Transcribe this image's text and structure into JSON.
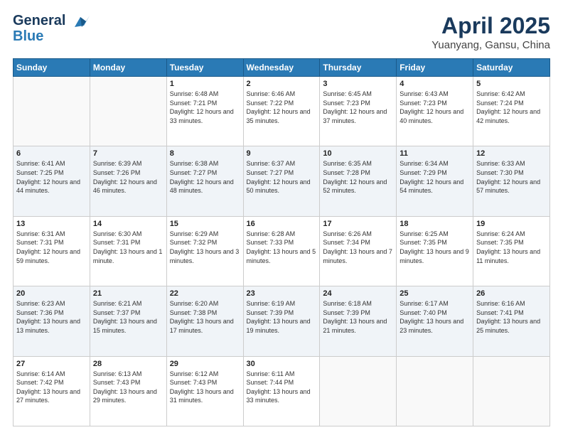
{
  "header": {
    "logo_line1": "General",
    "logo_line2": "Blue",
    "title": "April 2025",
    "subtitle": "Yuanyang, Gansu, China"
  },
  "weekdays": [
    "Sunday",
    "Monday",
    "Tuesday",
    "Wednesday",
    "Thursday",
    "Friday",
    "Saturday"
  ],
  "weeks": [
    [
      {
        "day": "",
        "info": ""
      },
      {
        "day": "",
        "info": ""
      },
      {
        "day": "1",
        "info": "Sunrise: 6:48 AM\nSunset: 7:21 PM\nDaylight: 12 hours and 33 minutes."
      },
      {
        "day": "2",
        "info": "Sunrise: 6:46 AM\nSunset: 7:22 PM\nDaylight: 12 hours and 35 minutes."
      },
      {
        "day": "3",
        "info": "Sunrise: 6:45 AM\nSunset: 7:23 PM\nDaylight: 12 hours and 37 minutes."
      },
      {
        "day": "4",
        "info": "Sunrise: 6:43 AM\nSunset: 7:23 PM\nDaylight: 12 hours and 40 minutes."
      },
      {
        "day": "5",
        "info": "Sunrise: 6:42 AM\nSunset: 7:24 PM\nDaylight: 12 hours and 42 minutes."
      }
    ],
    [
      {
        "day": "6",
        "info": "Sunrise: 6:41 AM\nSunset: 7:25 PM\nDaylight: 12 hours and 44 minutes."
      },
      {
        "day": "7",
        "info": "Sunrise: 6:39 AM\nSunset: 7:26 PM\nDaylight: 12 hours and 46 minutes."
      },
      {
        "day": "8",
        "info": "Sunrise: 6:38 AM\nSunset: 7:27 PM\nDaylight: 12 hours and 48 minutes."
      },
      {
        "day": "9",
        "info": "Sunrise: 6:37 AM\nSunset: 7:27 PM\nDaylight: 12 hours and 50 minutes."
      },
      {
        "day": "10",
        "info": "Sunrise: 6:35 AM\nSunset: 7:28 PM\nDaylight: 12 hours and 52 minutes."
      },
      {
        "day": "11",
        "info": "Sunrise: 6:34 AM\nSunset: 7:29 PM\nDaylight: 12 hours and 54 minutes."
      },
      {
        "day": "12",
        "info": "Sunrise: 6:33 AM\nSunset: 7:30 PM\nDaylight: 12 hours and 57 minutes."
      }
    ],
    [
      {
        "day": "13",
        "info": "Sunrise: 6:31 AM\nSunset: 7:31 PM\nDaylight: 12 hours and 59 minutes."
      },
      {
        "day": "14",
        "info": "Sunrise: 6:30 AM\nSunset: 7:31 PM\nDaylight: 13 hours and 1 minute."
      },
      {
        "day": "15",
        "info": "Sunrise: 6:29 AM\nSunset: 7:32 PM\nDaylight: 13 hours and 3 minutes."
      },
      {
        "day": "16",
        "info": "Sunrise: 6:28 AM\nSunset: 7:33 PM\nDaylight: 13 hours and 5 minutes."
      },
      {
        "day": "17",
        "info": "Sunrise: 6:26 AM\nSunset: 7:34 PM\nDaylight: 13 hours and 7 minutes."
      },
      {
        "day": "18",
        "info": "Sunrise: 6:25 AM\nSunset: 7:35 PM\nDaylight: 13 hours and 9 minutes."
      },
      {
        "day": "19",
        "info": "Sunrise: 6:24 AM\nSunset: 7:35 PM\nDaylight: 13 hours and 11 minutes."
      }
    ],
    [
      {
        "day": "20",
        "info": "Sunrise: 6:23 AM\nSunset: 7:36 PM\nDaylight: 13 hours and 13 minutes."
      },
      {
        "day": "21",
        "info": "Sunrise: 6:21 AM\nSunset: 7:37 PM\nDaylight: 13 hours and 15 minutes."
      },
      {
        "day": "22",
        "info": "Sunrise: 6:20 AM\nSunset: 7:38 PM\nDaylight: 13 hours and 17 minutes."
      },
      {
        "day": "23",
        "info": "Sunrise: 6:19 AM\nSunset: 7:39 PM\nDaylight: 13 hours and 19 minutes."
      },
      {
        "day": "24",
        "info": "Sunrise: 6:18 AM\nSunset: 7:39 PM\nDaylight: 13 hours and 21 minutes."
      },
      {
        "day": "25",
        "info": "Sunrise: 6:17 AM\nSunset: 7:40 PM\nDaylight: 13 hours and 23 minutes."
      },
      {
        "day": "26",
        "info": "Sunrise: 6:16 AM\nSunset: 7:41 PM\nDaylight: 13 hours and 25 minutes."
      }
    ],
    [
      {
        "day": "27",
        "info": "Sunrise: 6:14 AM\nSunset: 7:42 PM\nDaylight: 13 hours and 27 minutes."
      },
      {
        "day": "28",
        "info": "Sunrise: 6:13 AM\nSunset: 7:43 PM\nDaylight: 13 hours and 29 minutes."
      },
      {
        "day": "29",
        "info": "Sunrise: 6:12 AM\nSunset: 7:43 PM\nDaylight: 13 hours and 31 minutes."
      },
      {
        "day": "30",
        "info": "Sunrise: 6:11 AM\nSunset: 7:44 PM\nDaylight: 13 hours and 33 minutes."
      },
      {
        "day": "",
        "info": ""
      },
      {
        "day": "",
        "info": ""
      },
      {
        "day": "",
        "info": ""
      }
    ]
  ]
}
